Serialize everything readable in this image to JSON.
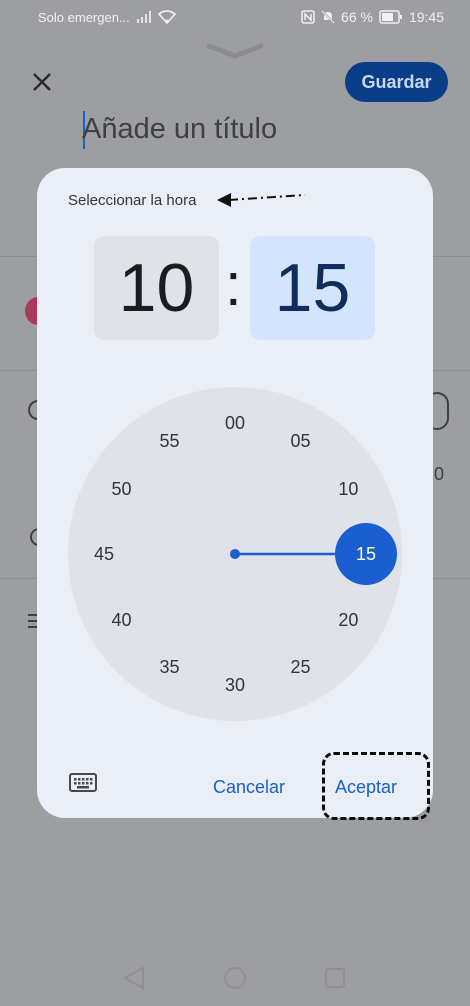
{
  "status_bar": {
    "carrier": "Solo emergen...",
    "battery": "66 %",
    "time": "19:45"
  },
  "form": {
    "save_label": "Guardar",
    "title_placeholder": "Añade un título",
    "bg_fragment": "0"
  },
  "time_picker": {
    "title": "Seleccionar la hora",
    "hour": "10",
    "separator": ":",
    "minute": "15",
    "selected_minute": 15,
    "dial_numbers": [
      "00",
      "05",
      "10",
      "15",
      "20",
      "25",
      "30",
      "35",
      "40",
      "45",
      "50",
      "55"
    ],
    "cancel_label": "Cancelar",
    "accept_label": "Aceptar"
  },
  "colors": {
    "accent": "#1a5ecf",
    "save_button": "#0a3d88",
    "dialog_bg": "#e9eef7",
    "dial_bg": "#dfe2e9",
    "minute_box": "#d5e4fd"
  },
  "icons": {
    "close": "close-icon",
    "keyboard": "keyboard-icon",
    "wifi": "wifi-icon",
    "battery": "battery-icon"
  }
}
